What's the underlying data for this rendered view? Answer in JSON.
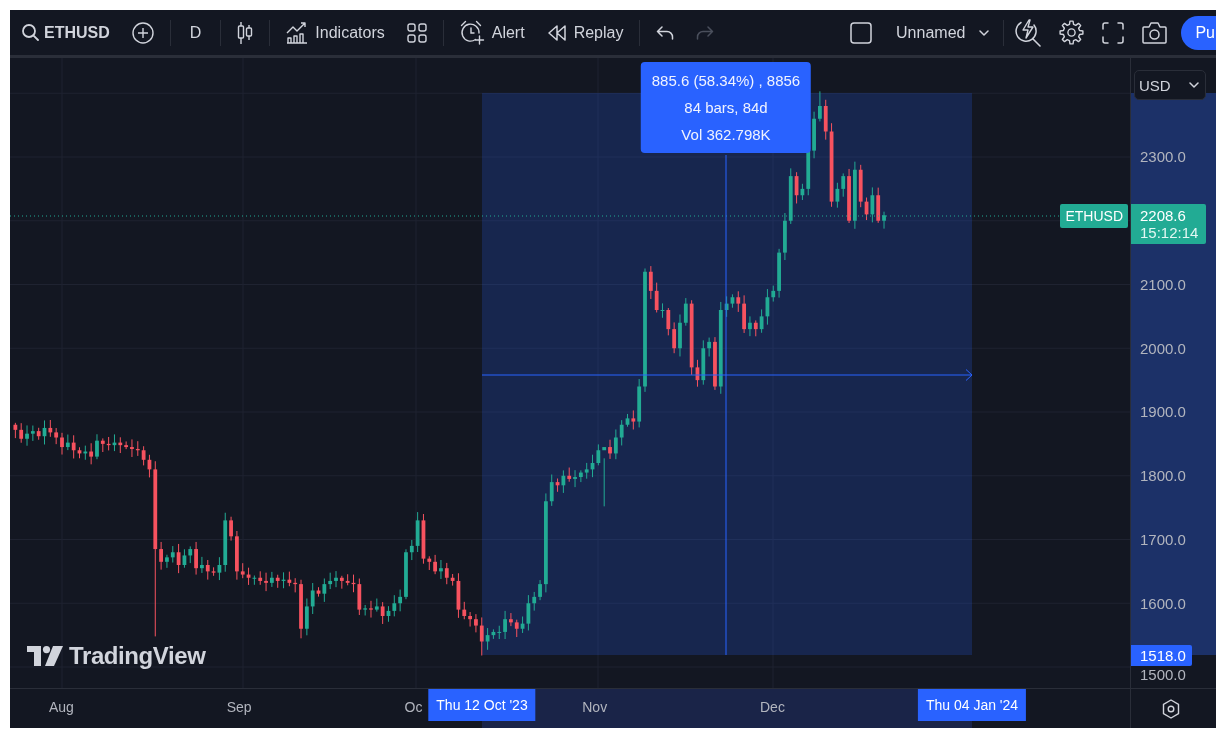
{
  "toolbar": {
    "left_groups": [
      [
        {
          "kind": "symbol",
          "label": "ETHUSD"
        },
        {
          "kind": "compare"
        }
      ],
      [
        {
          "kind": "interval",
          "label": "D"
        }
      ],
      [
        {
          "kind": "chart_style"
        }
      ],
      [
        {
          "kind": "indicators",
          "label": "Indicators"
        },
        {
          "kind": "layouts"
        }
      ],
      [
        {
          "kind": "alert",
          "label": "Alert"
        },
        {
          "kind": "replay",
          "label": "Replay"
        }
      ],
      [
        {
          "kind": "undo",
          "disabled": false
        },
        {
          "kind": "redo",
          "disabled": true
        }
      ]
    ],
    "right_groups": [
      [
        {
          "kind": "square"
        },
        {
          "kind": "layout_menu",
          "label": "Unnamed"
        }
      ],
      [
        {
          "kind": "quick_search"
        },
        {
          "kind": "settings"
        },
        {
          "kind": "fullscreen"
        },
        {
          "kind": "snapshot"
        },
        {
          "kind": "publish",
          "label": "Pu"
        }
      ]
    ]
  },
  "chart": {
    "measure_tooltip": [
      "885.6 (58.34%) , 8856",
      "84 bars, 84d",
      "Vol 362.798K"
    ],
    "symbol_label": "ETHUSD",
    "logo": "TradingView",
    "price_axis": {
      "currency": "USD",
      "labels": [
        "2300.0",
        "2100.0",
        "2000.0",
        "1900.0",
        "1800.0",
        "1700.0",
        "1600.0",
        "1500.0"
      ],
      "last_price": "2208.6",
      "countdown": "15:12:14",
      "range_low": "1518.0"
    },
    "time_axis": {
      "labels": [
        "Aug",
        "Sep",
        "Oc",
        "Nov",
        "Dec"
      ],
      "range_start": "Thu 12 Oct '23",
      "range_end": "Thu 04 Jan '24"
    }
  }
}
